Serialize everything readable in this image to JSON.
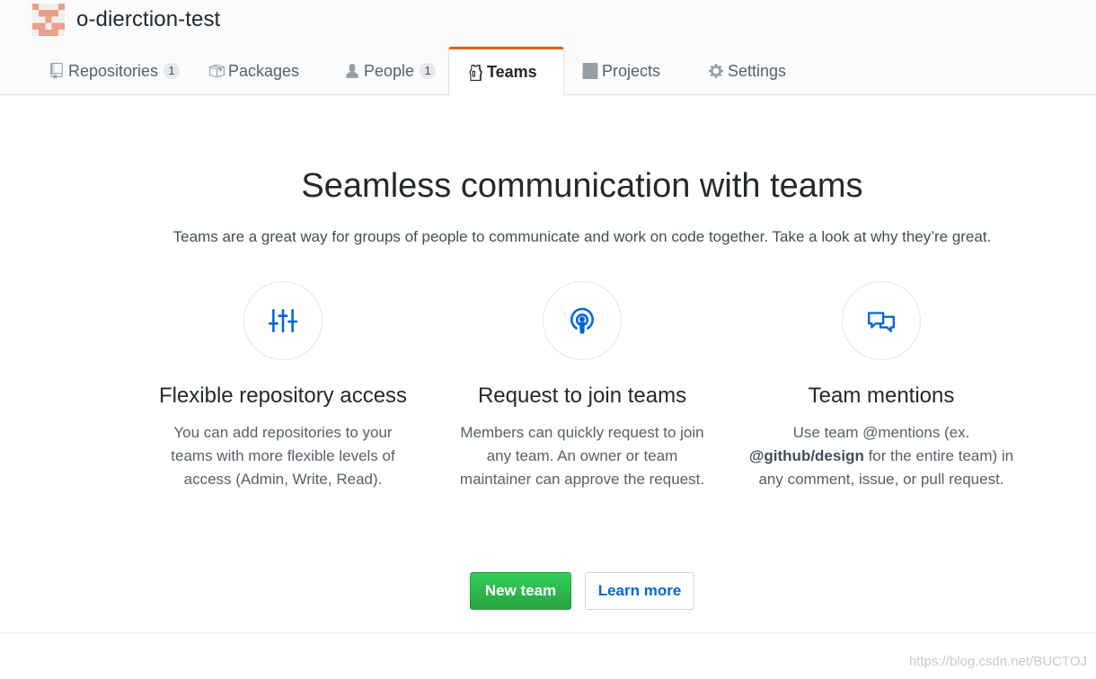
{
  "org": {
    "name": "o-dierction-test",
    "avatar_icon": "identicon-avatar"
  },
  "tabs": [
    {
      "label": "Repositories",
      "count": "1",
      "icon": "repo-icon"
    },
    {
      "label": "Packages",
      "icon": "package-icon"
    },
    {
      "label": "People",
      "count": "1",
      "icon": "person-icon"
    },
    {
      "label": "Teams",
      "icon": "jersey-icon",
      "selected": true
    },
    {
      "label": "Projects",
      "icon": "project-icon"
    },
    {
      "label": "Settings",
      "icon": "gear-icon"
    }
  ],
  "hero": {
    "title": "Seamless communication with teams",
    "subtitle": "Teams are a great way for groups of people to communicate and work on code together. Take a look at why they’re great."
  },
  "features": [
    {
      "title": "Flexible repository access",
      "description": "You can add repositories to your teams with more flexible levels of access (Admin, Write, Read).",
      "icon": "sliders-icon"
    },
    {
      "title": "Request to join teams",
      "description": "Members can quickly request to join any team. An owner or team maintainer can approve the request.",
      "icon": "broadcast-icon"
    },
    {
      "title": "Team mentions",
      "description_prefix": "Use team @mentions (ex.",
      "description_bold": "@github/design",
      "description_suffix": " for the entire team) in any comment, issue, or pull request.",
      "icon": "comment-discussion-icon"
    }
  ],
  "buttons": {
    "new_team": "New team",
    "learn_more": "Learn more"
  },
  "watermark": "https://blog.csdn.net/BUCTOJ",
  "colors": {
    "accent_tab": "#e36209",
    "primary_green": "#28a745",
    "link_blue": "#0366d6",
    "icon_blue": "#0366d6"
  }
}
